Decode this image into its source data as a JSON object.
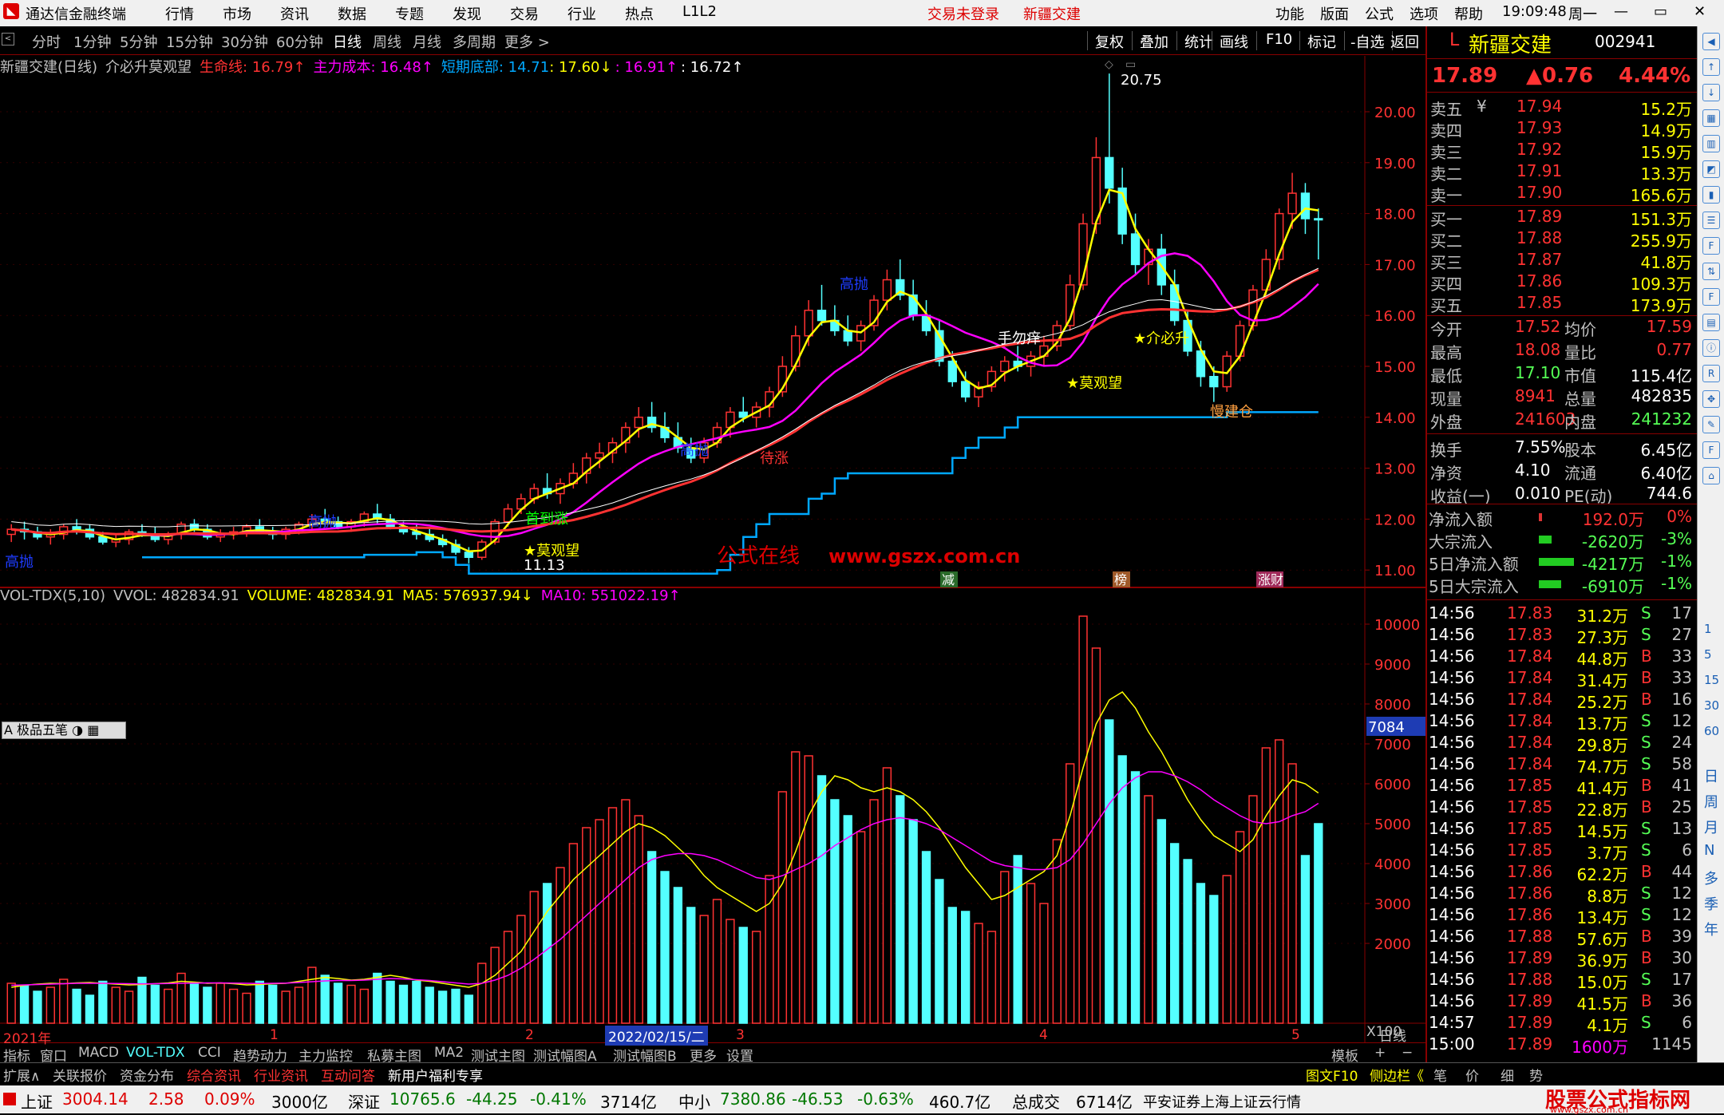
{
  "menu": {
    "title": "通达信金融终端",
    "items": [
      "行情",
      "市场",
      "资讯",
      "数据",
      "专题",
      "发现",
      "交易",
      "行业",
      "热点",
      "L1L2"
    ],
    "alert1": "交易未登录",
    "alert2": "新疆交建",
    "right": [
      "功能",
      "版面",
      "公式",
      "选项",
      "帮助"
    ],
    "time": "19:09:48",
    "weekday": "周一",
    "win": [
      "—",
      "▭",
      "✕"
    ]
  },
  "toolbar": {
    "periods": [
      "分时",
      "1分钟",
      "5分钟",
      "15分钟",
      "30分钟",
      "60分钟",
      "日线",
      "周线",
      "月线",
      "多周期",
      "更多 >"
    ],
    "selected": "日线",
    "right": [
      "复权",
      "叠加",
      "统计",
      "画线",
      "F10",
      "标记",
      "-自选",
      "返回"
    ]
  },
  "legend": {
    "name": "新疆交建(日线)",
    "formula": "介必升莫观望",
    "lifeline": "生命线: 16.79↑",
    "cost": "主力成本: 16.48↑",
    "bottom": "短期底部: 14.71",
    "v2": ": 17.60↓",
    "v3": ": 16.91↑",
    "v4": ": 16.72↑"
  },
  "volume_legend": {
    "name": "VOL-TDX(5,10)",
    "vvol": "VVOL: 482834.91",
    "volume": "VOLUME: 482834.91",
    "ma5": "MA5: 576937.94↓",
    "ma10": "MA10: 551022.19↑"
  },
  "watermark": {
    "cn": "公式在线",
    "url": "www.gszx.com.cn"
  },
  "price_axis": [
    "20.00",
    "19.00",
    "18.00",
    "17.00",
    "16.00",
    "15.00",
    "14.00",
    "13.00",
    "12.00",
    "11.00"
  ],
  "volume_axis": [
    "10000",
    "9000",
    "8000",
    "7000",
    "6000",
    "5000",
    "4000",
    "3000",
    "2000"
  ],
  "volume_axis_unit": "X100",
  "volume_marker": "7084",
  "date_axis": [
    "2021年",
    "1",
    "2",
    "3",
    "4",
    "5"
  ],
  "date_cursor": "2022/02/15/二",
  "date_axis_right": "日线",
  "chart_annotations": [
    "高抛",
    "高抛",
    "高抛",
    "高抛",
    "手勿痒",
    "★莫观望",
    "★介必升",
    "慢建仓",
    "★莫观望",
    "首到涨",
    "待涨",
    "20.75",
    "11.13"
  ],
  "event_markers": [
    "减",
    "榜",
    "涨财"
  ],
  "wuxia_button": "极品五笔",
  "chart_data": {
    "type": "candlestick",
    "ylim": [
      10.8,
      20.9
    ],
    "candles": [
      [
        11.7,
        11.9,
        11.55,
        11.8
      ],
      [
        11.8,
        11.95,
        11.6,
        11.75
      ],
      [
        11.75,
        11.85,
        11.6,
        11.65
      ],
      [
        11.65,
        11.8,
        11.5,
        11.7
      ],
      [
        11.7,
        11.9,
        11.6,
        11.85
      ],
      [
        11.85,
        12.0,
        11.7,
        11.8
      ],
      [
        11.8,
        11.9,
        11.6,
        11.65
      ],
      [
        11.65,
        11.75,
        11.5,
        11.55
      ],
      [
        11.55,
        11.7,
        11.45,
        11.6
      ],
      [
        11.6,
        11.8,
        11.5,
        11.75
      ],
      [
        11.75,
        11.9,
        11.65,
        11.7
      ],
      [
        11.7,
        11.85,
        11.55,
        11.6
      ],
      [
        11.6,
        11.75,
        11.5,
        11.7
      ],
      [
        11.7,
        11.95,
        11.6,
        11.9
      ],
      [
        11.9,
        12.0,
        11.75,
        11.8
      ],
      [
        11.8,
        11.9,
        11.6,
        11.65
      ],
      [
        11.65,
        11.8,
        11.55,
        11.7
      ],
      [
        11.7,
        11.85,
        11.6,
        11.75
      ],
      [
        11.75,
        11.9,
        11.65,
        11.85
      ],
      [
        11.85,
        12.0,
        11.7,
        11.75
      ],
      [
        11.75,
        11.85,
        11.6,
        11.7
      ],
      [
        11.7,
        11.85,
        11.6,
        11.8
      ],
      [
        11.8,
        11.95,
        11.7,
        11.9
      ],
      [
        11.9,
        12.1,
        11.8,
        12.0
      ],
      [
        12.0,
        12.2,
        11.85,
        11.95
      ],
      [
        11.95,
        12.05,
        11.8,
        11.85
      ],
      [
        11.85,
        12.0,
        11.75,
        11.95
      ],
      [
        11.95,
        12.15,
        11.85,
        12.1
      ],
      [
        12.1,
        12.3,
        11.9,
        12.0
      ],
      [
        12.0,
        12.1,
        11.8,
        11.85
      ],
      [
        11.85,
        11.95,
        11.7,
        11.75
      ],
      [
        11.75,
        11.9,
        11.6,
        11.7
      ],
      [
        11.7,
        11.85,
        11.55,
        11.6
      ],
      [
        11.6,
        11.7,
        11.45,
        11.5
      ],
      [
        11.5,
        11.6,
        11.3,
        11.35
      ],
      [
        11.35,
        11.45,
        11.13,
        11.25
      ],
      [
        11.25,
        11.6,
        11.2,
        11.55
      ],
      [
        11.55,
        12.0,
        11.5,
        11.95
      ],
      [
        11.95,
        12.3,
        11.85,
        12.2
      ],
      [
        12.2,
        12.5,
        12.1,
        12.4
      ],
      [
        12.4,
        12.7,
        12.3,
        12.6
      ],
      [
        12.6,
        12.9,
        12.4,
        12.5
      ],
      [
        12.5,
        12.8,
        12.3,
        12.7
      ],
      [
        12.7,
        13.1,
        12.6,
        12.9
      ],
      [
        12.9,
        13.3,
        12.7,
        13.2
      ],
      [
        13.2,
        13.5,
        13.0,
        13.3
      ],
      [
        13.3,
        13.6,
        13.1,
        13.5
      ],
      [
        13.5,
        13.9,
        13.3,
        13.8
      ],
      [
        13.8,
        14.2,
        13.6,
        14.0
      ],
      [
        14.0,
        14.3,
        13.7,
        13.8
      ],
      [
        13.8,
        14.1,
        13.5,
        13.6
      ],
      [
        13.6,
        13.9,
        13.3,
        13.4
      ],
      [
        13.4,
        13.6,
        13.1,
        13.2
      ],
      [
        13.2,
        13.6,
        13.1,
        13.5
      ],
      [
        13.5,
        13.9,
        13.4,
        13.8
      ],
      [
        13.8,
        14.2,
        13.6,
        14.1
      ],
      [
        14.1,
        14.4,
        13.9,
        14.0
      ],
      [
        14.0,
        14.3,
        13.8,
        14.2
      ],
      [
        14.2,
        14.6,
        14.0,
        14.5
      ],
      [
        14.5,
        15.2,
        14.4,
        15.0
      ],
      [
        15.0,
        15.8,
        14.9,
        15.6
      ],
      [
        15.6,
        16.3,
        15.4,
        16.1
      ],
      [
        16.1,
        16.6,
        15.8,
        15.9
      ],
      [
        15.9,
        16.2,
        15.6,
        15.7
      ],
      [
        15.7,
        16.0,
        15.4,
        15.5
      ],
      [
        15.5,
        15.9,
        15.3,
        15.8
      ],
      [
        15.8,
        16.4,
        15.7,
        16.3
      ],
      [
        16.3,
        16.9,
        16.1,
        16.7
      ],
      [
        16.7,
        17.1,
        16.3,
        16.4
      ],
      [
        16.4,
        16.7,
        15.9,
        16.0
      ],
      [
        16.0,
        16.3,
        15.6,
        15.7
      ],
      [
        15.7,
        15.9,
        15.0,
        15.1
      ],
      [
        15.1,
        15.3,
        14.6,
        14.7
      ],
      [
        14.7,
        14.9,
        14.3,
        14.4
      ],
      [
        14.4,
        14.7,
        14.2,
        14.6
      ],
      [
        14.6,
        15.0,
        14.5,
        14.9
      ],
      [
        14.9,
        15.2,
        14.7,
        15.1
      ],
      [
        15.1,
        15.4,
        14.9,
        15.0
      ],
      [
        15.0,
        15.3,
        14.8,
        15.2
      ],
      [
        15.2,
        15.6,
        15.0,
        15.4
      ],
      [
        15.4,
        15.9,
        15.3,
        15.8
      ],
      [
        15.8,
        16.8,
        15.7,
        16.6
      ],
      [
        16.6,
        18.0,
        16.5,
        17.8
      ],
      [
        17.8,
        19.5,
        17.6,
        19.1
      ],
      [
        19.1,
        20.75,
        18.2,
        18.5
      ],
      [
        18.5,
        18.9,
        17.4,
        17.6
      ],
      [
        17.6,
        18.0,
        16.8,
        17.0
      ],
      [
        17.0,
        17.5,
        16.6,
        17.3
      ],
      [
        17.3,
        17.6,
        16.4,
        16.6
      ],
      [
        16.6,
        16.9,
        15.8,
        15.9
      ],
      [
        15.9,
        16.1,
        15.2,
        15.3
      ],
      [
        15.3,
        15.5,
        14.6,
        14.8
      ],
      [
        14.8,
        15.0,
        14.3,
        14.6
      ],
      [
        14.6,
        15.3,
        14.5,
        15.2
      ],
      [
        15.2,
        15.9,
        15.1,
        15.8
      ],
      [
        15.8,
        16.6,
        15.7,
        16.5
      ],
      [
        16.5,
        17.3,
        16.4,
        17.1
      ],
      [
        17.1,
        18.1,
        16.9,
        18.0
      ],
      [
        18.0,
        18.8,
        17.7,
        18.4
      ],
      [
        18.4,
        18.6,
        17.6,
        17.9
      ],
      [
        17.9,
        18.1,
        17.1,
        17.89
      ]
    ],
    "volume": [
      1000,
      950,
      800,
      900,
      1100,
      850,
      700,
      1050,
      900,
      800,
      1150,
      950,
      850,
      1250,
      1000,
      900,
      1000,
      850,
      750,
      1050,
      950,
      800,
      900,
      1400,
      1200,
      1000,
      950,
      850,
      1250,
      1050,
      950,
      1050,
      900,
      800,
      850,
      700,
      1500,
      1900,
      2300,
      2700,
      3300,
      3500,
      3900,
      4500,
      4900,
      5100,
      5400,
      5600,
      5200,
      4300,
      3800,
      3400,
      2900,
      2700,
      3100,
      2600,
      2400,
      2300,
      3700,
      5800,
      6800,
      6700,
      6200,
      5600,
      5200,
      4800,
      5600,
      6400,
      5700,
      5100,
      4300,
      3600,
      2900,
      2800,
      2500,
      2300,
      3800,
      4200,
      3500,
      3000,
      4600,
      6500,
      10200,
      9400,
      7600,
      6700,
      6300,
      5700,
      5100,
      4500,
      4100,
      3500,
      3200,
      3700,
      4800,
      5700,
      6900,
      7100,
      6500,
      4200,
      5000
    ],
    "ma5": [
      900,
      950,
      980,
      1000,
      990,
      1010,
      1020,
      1000,
      980,
      960,
      970,
      990,
      1010,
      1050,
      1030,
      1000,
      1010,
      990,
      960,
      970,
      990,
      1000,
      1050,
      1100,
      1150,
      1120,
      1080,
      1100,
      1150,
      1200,
      1150,
      1080,
      1050,
      1000,
      950,
      900,
      1000,
      1200,
      1500,
      1800,
      2300,
      2800,
      3200,
      3600,
      3900,
      4200,
      4500,
      4800,
      5000,
      4900,
      4700,
      4400,
      4100,
      3700,
      3400,
      3200,
      3000,
      2800,
      3000,
      3500,
      4300,
      5200,
      5800,
      6200,
      6100,
      5900,
      5800,
      5900,
      5800,
      5600,
      5300,
      4900,
      4400,
      3900,
      3500,
      3100,
      3200,
      3400,
      3600,
      3800,
      4200,
      5200,
      6400,
      7500,
      8100,
      8300,
      7900,
      7300,
      6800,
      6200,
      5600,
      5100,
      4700,
      4500,
      4300,
      4600,
      5200,
      5700,
      6100,
      6000,
      5769
    ],
    "ma10": [
      950,
      960,
      970,
      980,
      990,
      1000,
      1000,
      1000,
      995,
      990,
      985,
      990,
      995,
      1000,
      1005,
      1010,
      1010,
      1005,
      1000,
      995,
      1000,
      1005,
      1020,
      1040,
      1060,
      1070,
      1070,
      1080,
      1100,
      1120,
      1110,
      1090,
      1070,
      1040,
      1010,
      980,
      1000,
      1080,
      1200,
      1380,
      1600,
      1850,
      2100,
      2400,
      2700,
      3000,
      3300,
      3600,
      3900,
      4100,
      4200,
      4250,
      4250,
      4200,
      4100,
      3950,
      3800,
      3650,
      3600,
      3700,
      3850,
      4000,
      4200,
      4450,
      4650,
      4850,
      5000,
      5100,
      5150,
      5100,
      5000,
      4850,
      4650,
      4450,
      4250,
      4050,
      3950,
      3900,
      3850,
      3850,
      3900,
      4100,
      4500,
      5000,
      5500,
      5900,
      6150,
      6300,
      6300,
      6200,
      6050,
      5850,
      5600,
      5400,
      5200,
      5050,
      5000,
      5050,
      5200,
      5300,
      5510
    ]
  },
  "quote": {
    "market_flag": "L",
    "name": "新疆交建",
    "code": "002941",
    "price": "17.89",
    "change": "▲0.76",
    "pct": "4.44%",
    "asks": [
      [
        "卖五",
        "¥",
        "17.94",
        "15.2万"
      ],
      [
        "卖四",
        "",
        "17.93",
        "14.9万"
      ],
      [
        "卖三",
        "",
        "17.92",
        "15.9万"
      ],
      [
        "卖二",
        "",
        "17.91",
        "13.3万"
      ],
      [
        "卖一",
        "",
        "17.90",
        "165.6万"
      ]
    ],
    "bids": [
      [
        "买一",
        "",
        "17.89",
        "151.3万"
      ],
      [
        "买二",
        "",
        "17.88",
        "255.9万"
      ],
      [
        "买三",
        "",
        "17.87",
        "41.8万"
      ],
      [
        "买四",
        "",
        "17.86",
        "109.3万"
      ],
      [
        "买五",
        "",
        "17.85",
        "173.9万"
      ]
    ],
    "stats": [
      [
        "今开",
        "17.52",
        "均价",
        "17.59"
      ],
      [
        "最高",
        "18.08",
        "量比",
        "0.77"
      ],
      [
        "最低",
        "17.10",
        "市值",
        "115.4亿"
      ],
      [
        "现量",
        "8941",
        "总量",
        "482835"
      ],
      [
        "外盘",
        "241603",
        "内盘",
        "241232"
      ],
      [
        "换手",
        "7.55%",
        "股本",
        "6.45亿"
      ],
      [
        "净资",
        "4.10",
        "流通",
        "6.40亿"
      ],
      [
        "收益(一)",
        "0.010",
        "PE(动)",
        "744.6"
      ]
    ],
    "flows": [
      [
        "净流入额",
        "192.0万",
        "0%"
      ],
      [
        "大宗流入",
        "-2620万",
        "-3%"
      ],
      [
        "5日净流入额",
        "-4217万",
        "-1%"
      ],
      [
        "5日大宗流入",
        "-6910万",
        "-1%"
      ]
    ],
    "ticks": [
      [
        "14:56",
        "17.83",
        "31.2万",
        "S",
        "17"
      ],
      [
        "14:56",
        "17.83",
        "27.3万",
        "S",
        "27"
      ],
      [
        "14:56",
        "17.84",
        "44.8万",
        "B",
        "33"
      ],
      [
        "14:56",
        "17.84",
        "31.4万",
        "B",
        "33"
      ],
      [
        "14:56",
        "17.84",
        "25.2万",
        "B",
        "16"
      ],
      [
        "14:56",
        "17.84",
        "13.7万",
        "S",
        "12"
      ],
      [
        "14:56",
        "17.84",
        "29.8万",
        "S",
        "24"
      ],
      [
        "14:56",
        "17.84",
        "74.7万",
        "S",
        "58"
      ],
      [
        "14:56",
        "17.85",
        "41.4万",
        "B",
        "41"
      ],
      [
        "14:56",
        "17.85",
        "22.8万",
        "B",
        "25"
      ],
      [
        "14:56",
        "17.85",
        "14.5万",
        "S",
        "13"
      ],
      [
        "14:56",
        "17.85",
        "3.7万",
        "S",
        "6"
      ],
      [
        "14:56",
        "17.86",
        "62.2万",
        "B",
        "44"
      ],
      [
        "14:56",
        "17.86",
        "8.8万",
        "S",
        "12"
      ],
      [
        "14:56",
        "17.86",
        "13.4万",
        "S",
        "12"
      ],
      [
        "14:56",
        "17.88",
        "57.6万",
        "B",
        "39"
      ],
      [
        "14:56",
        "17.89",
        "36.9万",
        "B",
        "30"
      ],
      [
        "14:56",
        "17.88",
        "15.0万",
        "S",
        "17"
      ],
      [
        "14:56",
        "17.89",
        "41.5万",
        "B",
        "36"
      ],
      [
        "14:57",
        "17.89",
        "4.1万",
        "S",
        "6"
      ],
      [
        "15:00",
        "17.89",
        "1600万",
        "",
        "1145"
      ]
    ]
  },
  "tabs1": [
    "指标",
    "窗口",
    "MACD",
    "VOL-TDX",
    "CCI",
    "趋势动力",
    "主力监控",
    "私募主图",
    "MA2",
    "测试主图",
    "测试幅图A",
    "测试幅图B",
    "更多",
    "设置",
    "模板",
    "+",
    "−"
  ],
  "tabs2": [
    "扩展∧",
    "关联报价",
    "资金分布",
    "综合资讯",
    "行业资讯",
    "互动问答",
    "新用户福利专享"
  ],
  "tabs2_right": [
    "图文F10",
    "侧边栏《",
    "笔",
    "价",
    "细",
    "势"
  ],
  "status": {
    "sh": "上证",
    "sh_v": "3004.14",
    "sh_c": "2.58",
    "sh_p": "0.09%",
    "sh_a": "3000亿",
    "sz": "深证",
    "sz_v": "10765.6",
    "sz_c": "-44.25",
    "sz_p": "-0.41%",
    "sz_a": "3714亿",
    "zx": "中小",
    "zx_v": "7380.86",
    "zx_c": "-46.53",
    "zx_p": "-0.63%",
    "zx_a": "460.7亿",
    "total": "总成交",
    "total_v": "6714亿",
    "broker": "平安证券上海上证云行情",
    "logo": "股票公式指标网",
    "logo_url": "www.gszx.com.cn"
  },
  "sidebar_letters": [
    "日",
    "周",
    "月",
    "N",
    "多",
    "季",
    "年"
  ],
  "sidebar_nums": [
    "1",
    "5",
    "15",
    "30",
    "60"
  ],
  "colors": {
    "up": "#ff3232",
    "down": "#54ffff",
    "ma_y": "#ffff00",
    "ma_m": "#ff00ff",
    "ma_r": "#ff3232",
    "bottom": "#00a8ff"
  }
}
